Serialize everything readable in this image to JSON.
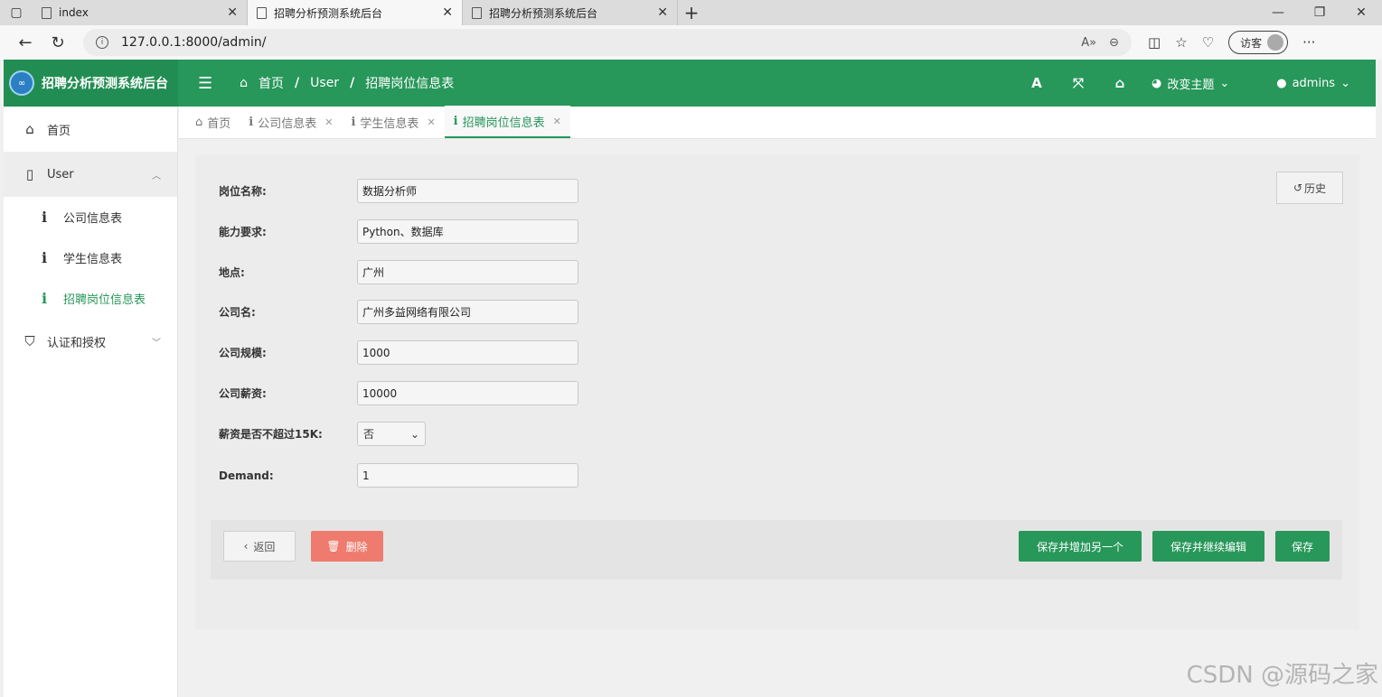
{
  "browser": {
    "tabs": [
      {
        "title": "index"
      },
      {
        "title": "招聘分析预测系统后台"
      },
      {
        "title": "招聘分析预测系统后台"
      }
    ],
    "url": "127.0.0.1:8000/admin/",
    "guest_label": "访客"
  },
  "header": {
    "brand": "招聘分析预测系统后台",
    "breadcrumb": [
      "首页",
      "User",
      "招聘岗位信息表"
    ],
    "font_icon": "A",
    "theme_label": "改变主题",
    "user_label": "admins",
    "accent": "#27975a"
  },
  "sidebar": {
    "home": "首页",
    "group_user": "User",
    "items": [
      "公司信息表",
      "学生信息表",
      "招聘岗位信息表"
    ],
    "group_auth": "认证和授权"
  },
  "content_tabs": [
    "首页",
    "公司信息表",
    "学生信息表",
    "招聘岗位信息表"
  ],
  "form": {
    "history_label": "历史",
    "fields": [
      {
        "label": "岗位名称:",
        "value": "数据分析师"
      },
      {
        "label": "能力要求:",
        "value": "Python、数据库"
      },
      {
        "label": "地点:",
        "value": "广州"
      },
      {
        "label": "公司名:",
        "value": "广州多益网络有限公司"
      },
      {
        "label": "公司规模:",
        "value": "1000"
      },
      {
        "label": "公司薪资:",
        "value": "10000"
      },
      {
        "label": "薪资是否不超过15K:",
        "value": "否"
      },
      {
        "label": "Demand:",
        "value": "1"
      }
    ]
  },
  "actions": {
    "back": "返回",
    "delete": "删除",
    "save_add": "保存并增加另一个",
    "save_continue": "保存并继续编辑",
    "save": "保存",
    "delete_color": "#ee7b6e"
  },
  "watermark": "CSDN @源码之家"
}
